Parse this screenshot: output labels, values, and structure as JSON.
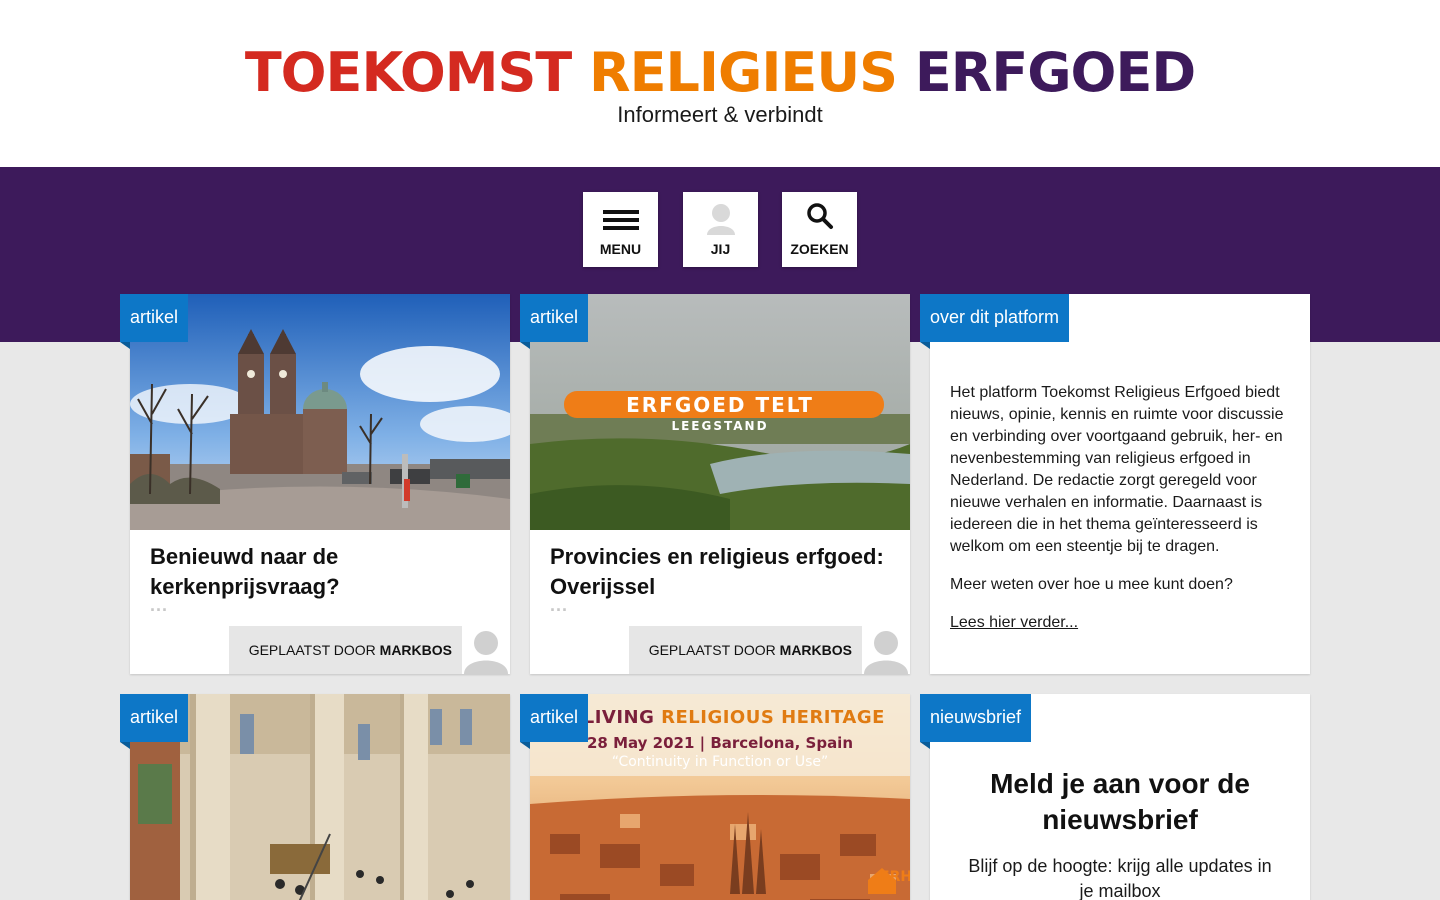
{
  "header": {
    "logo": {
      "word1": "TOEKOMST",
      "word2": "RELIGIEUS",
      "word3": "ERFGOED"
    },
    "tagline": "Informeert & verbindt"
  },
  "nav": {
    "menu_label": "MENU",
    "user_label": "JIJ",
    "search_label": "ZOEKEN"
  },
  "cards": [
    {
      "tag": "artikel",
      "title": "Benieuwd naar de kerkenprijsvraag?",
      "dots": "...",
      "posted_by_label": "GEPLAATST DOOR",
      "author": "MARKBOS"
    },
    {
      "tag": "artikel",
      "title": "Provincies en religieus erfgoed: Overijssel",
      "dots": "...",
      "posted_by_label": "GEPLAATST DOOR",
      "author": "MARKBOS",
      "image_banner_title": "ERFGOED TELT",
      "image_banner_subtitle": "LEEGSTAND"
    },
    {
      "tag": "artikel"
    },
    {
      "tag": "artikel",
      "image_line1a": "PE'S LIVING ",
      "image_line1b": "RELIGIOUS HERITAGE",
      "image_line2": "28 May 2021 | Barcelona, Spain",
      "image_line3": "“Continuity in Function or Use”",
      "image_logo": "FRH"
    }
  ],
  "about": {
    "tag": "over dit platform",
    "paragraph1": "Het platform Toekomst Religieus Erfgoed biedt nieuws, opinie, kennis en ruimte voor discussie en verbinding over voortgaand gebruik, her- en nevenbestemming van religieus erfgoed in Nederland. De redactie zorgt geregeld voor nieuwe verhalen en informatie. Daarnaast is iedereen die in het thema geïnteresseerd is welkom om een steentje bij te dragen.",
    "paragraph2": "Meer weten over hoe u mee kunt doen?",
    "link": "Lees hier verder..."
  },
  "newsletter": {
    "tag": "nieuwsbrief",
    "title": "Meld je aan voor de nieuwsbrief",
    "text": "Blijf op de hoogte: krijg alle updates in je mailbox"
  },
  "colors": {
    "logo_red": "#d42a20",
    "logo_orange": "#ef7d00",
    "logo_purple": "#3d1a5b",
    "nav_band": "#3d1a5b",
    "tag_blue": "#0d77c7"
  }
}
